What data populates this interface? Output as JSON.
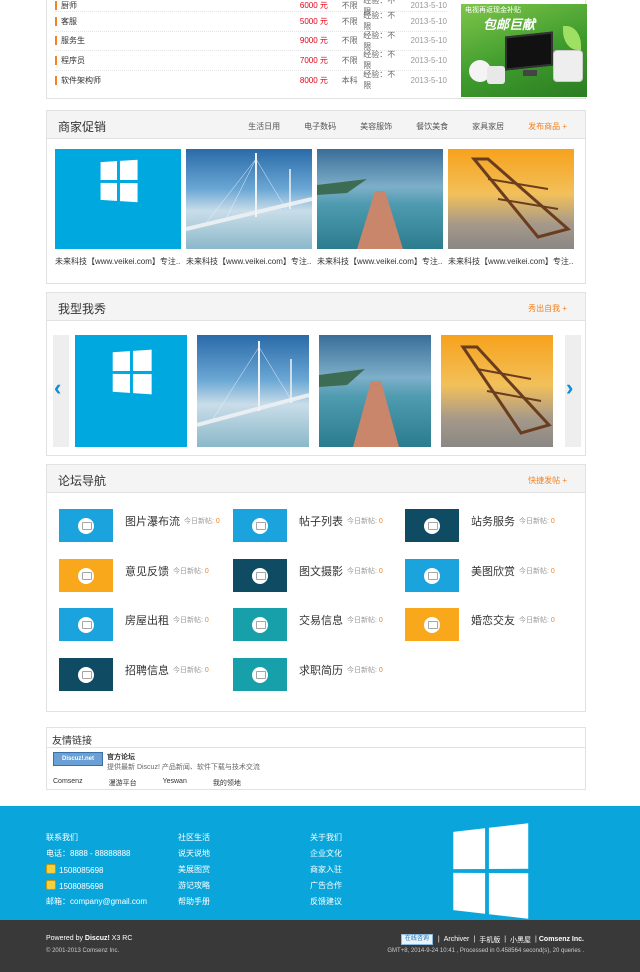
{
  "jobs": [
    {
      "title": "厨师",
      "salary": "6000 元",
      "edu": "不限",
      "exp": "经验：不限",
      "date": "2013-5-10"
    },
    {
      "title": "客服",
      "salary": "5000 元",
      "edu": "不限",
      "exp": "经验：不限",
      "date": "2013-5-10"
    },
    {
      "title": "服务生",
      "salary": "9000 元",
      "edu": "不限",
      "exp": "经验：不限",
      "date": "2013-5-10"
    },
    {
      "title": "程序员",
      "salary": "7000 元",
      "edu": "不限",
      "exp": "经验：不限",
      "date": "2013-5-10"
    },
    {
      "title": "软件架构师",
      "salary": "8000 元",
      "edu": "本科",
      "exp": "经验：不限",
      "date": "2013-5-10"
    }
  ],
  "ad": {
    "line1": "电视再返现金补贴",
    "line2": "包邮巨献"
  },
  "promo": {
    "title": "商家促销",
    "tabs": [
      "生活日用",
      "电子数码",
      "美容服饰",
      "餐饮美食",
      "家具家居"
    ],
    "more": "发布商品 +",
    "captions": [
      "未来科技【www.veikei.com】专注...",
      "未来科技【www.veikei.com】专注...",
      "未来科技【www.veikei.com】专注...",
      "未来科技【www.veikei.com】专注..."
    ]
  },
  "show": {
    "title": "我型我秀",
    "more": "秀出自我 +",
    "prev": "‹",
    "next": "›"
  },
  "forum": {
    "title": "论坛导航",
    "more": "快捷发帖 +",
    "stat_label": "今日新帖:",
    "items": [
      {
        "name": "图片瀑布流",
        "count": "0",
        "color": "#1ba3dd"
      },
      {
        "name": "帖子列表",
        "count": "0",
        "color": "#1ba3dd"
      },
      {
        "name": "站务服务",
        "count": "0",
        "color": "#0f4b63"
      },
      {
        "name": "意见反馈",
        "count": "0",
        "color": "#f9a81b"
      },
      {
        "name": "图文摄影",
        "count": "0",
        "color": "#0f4b63"
      },
      {
        "name": "美图欣赏",
        "count": "0",
        "color": "#1ba3dd"
      },
      {
        "name": "房屋出租",
        "count": "0",
        "color": "#1ba3dd"
      },
      {
        "name": "交易信息",
        "count": "0",
        "color": "#17a0aa"
      },
      {
        "name": "婚恋交友",
        "count": "0",
        "color": "#f9a81b"
      },
      {
        "name": "招聘信息",
        "count": "0",
        "color": "#0f4b63"
      },
      {
        "name": "求职简历",
        "count": "0",
        "color": "#17a0aa"
      }
    ]
  },
  "links": {
    "title": "友情链接",
    "logo_text": "Discuz!.net",
    "feature_name": "官方论坛",
    "feature_desc": "提供最新 Discuz! 产品新闻、软件下载与技术交流",
    "items": [
      "Comsenz",
      "漫游平台",
      "Yeswan",
      "我的领地"
    ]
  },
  "footer": {
    "contact": [
      "联系我们",
      "电话：8888 - 88888888",
      "1508085698",
      "1508085698",
      "邮箱：company@gmail.com"
    ],
    "community": [
      "社区生活",
      "说天说地",
      "美展图赏",
      "游记攻略",
      "帮助手册"
    ],
    "about": [
      "关于我们",
      "企业文化",
      "商家入驻",
      "广告合作",
      "反馈建议"
    ]
  },
  "bottom": {
    "powered_prefix": "Powered by",
    "powered_brand": "Discuz!",
    "powered_version": "X3 RC",
    "copyright": "© 2001-2013 Comsenz Inc.",
    "online": "在线咨询",
    "links": [
      "Archiver",
      "手机版",
      "小黑屋"
    ],
    "company": "Comsenz Inc.",
    "stats": "GMT+8, 2014-9-24 10:41 , Processed in 0.458564 second(s), 20 queries ."
  }
}
